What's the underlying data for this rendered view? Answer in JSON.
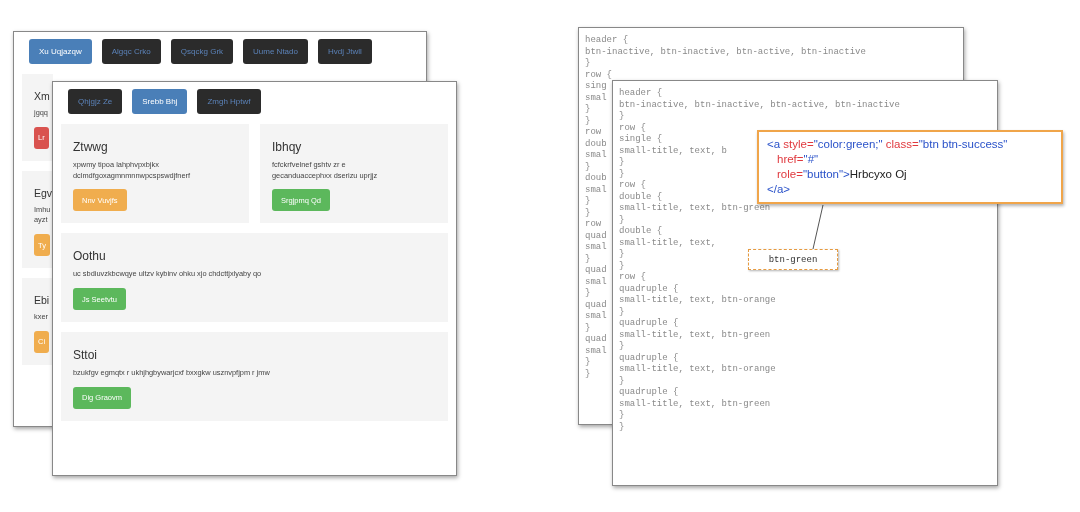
{
  "web_windows": [
    {
      "nav": [
        {
          "label": "Xu Uqjazqw",
          "selected": true
        },
        {
          "label": "Algqc Crko",
          "selected": false
        },
        {
          "label": "Qsqckg Grk",
          "selected": false
        },
        {
          "label": "Uume Ntado",
          "selected": false
        },
        {
          "label": "Hvdj Jtwll",
          "selected": false
        }
      ],
      "rows": [
        {
          "cards": [
            {
              "title": "Xm",
              "lines": [
                "jgqq"
              ],
              "button": {
                "label": "Lr",
                "color": "#d9534f"
              }
            }
          ]
        },
        {
          "cards": [
            {
              "title": "Egv",
              "lines": [
                "Imhu",
                "ayzt"
              ],
              "button": {
                "label": "Ty",
                "color": "#f0ad4e"
              }
            }
          ]
        },
        {
          "cards": [
            {
              "title": "Ebi",
              "lines": [
                "kxer"
              ],
              "button": {
                "label": "Ci",
                "color": "#f0ad4e"
              }
            }
          ]
        }
      ]
    },
    {
      "nav": [
        {
          "label": "Qhjgjz Ze",
          "selected": false
        },
        {
          "label": "Srebb Bhj",
          "selected": true
        },
        {
          "label": "Zmgh Hptwf",
          "selected": false
        }
      ],
      "rows": [
        {
          "cards": [
            {
              "title": "Ztwwg",
              "lines": [
                "xpwmy tipoa lahphvpxbjkx",
                "dclmdfgoxagmnmnnwpcspswdjfnerf"
              ],
              "button": {
                "label": "Nnv Vuvjfs",
                "color": "#f0ad4e"
              }
            },
            {
              "title": "Ibhqy",
              "lines": [
                "fcfckrfvelnef gshtv zr e",
                "gecanduaccephxx dserizu uprjjz"
              ],
              "button": {
                "label": "Srgjpmq Qd",
                "color": "#5cb85c"
              }
            }
          ]
        },
        {
          "cards": [
            {
              "title": "Oothu",
              "lines": [
                "uc sbdiuvzkbcwqye ultzv kybinv ohku xjo chdcttjxlyaby qo"
              ],
              "button": {
                "label": "Js Seetvtu",
                "color": "#5cb85c"
              }
            }
          ]
        },
        {
          "cards": [
            {
              "title": "Sttoi",
              "lines": [
                "bzukfgv egmqtx r ukhjhgbywarjcxf bxxgkw usznvpfjpm r jmw"
              ],
              "button": {
                "label": "Dig Graovm",
                "color": "#5cb85c"
              }
            }
          ]
        }
      ]
    }
  ],
  "code_windows": [
    {
      "lines": [
        "header {",
        "btn-inactive, btn-inactive, btn-active, btn-inactive",
        "}",
        "row {",
        "sing",
        "smal",
        "}",
        "}",
        "row",
        "doub",
        "smal",
        "}",
        "doub",
        "smal",
        "}",
        "}",
        "row",
        "quad",
        "smal",
        "}",
        "quad",
        "smal",
        "}",
        "quad",
        "smal",
        "}",
        "quad",
        "smal",
        "}",
        "}"
      ]
    },
    {
      "lines": [
        "header {",
        "btn-inactive, btn-inactive, btn-active, btn-inactive",
        "}",
        "row {",
        "single {",
        "small-title, text, b",
        "}",
        "}",
        "row {",
        "double {",
        "small-title, text, btn-green",
        "}",
        "double {",
        "small-title, text,",
        "}",
        "}",
        "row {",
        "quadruple {",
        "small-title, text, btn-orange",
        "}",
        "quadruple {",
        "small-title, text, btn-green",
        "}",
        "quadruple {",
        "small-title, text, btn-orange",
        "}",
        "quadruple {",
        "small-title, text, btn-green",
        "}",
        "}"
      ]
    }
  ],
  "callout": {
    "lines": [
      [
        {
          "text": "<a",
          "kind": "tag"
        },
        {
          "text": " style=",
          "kind": "attr"
        },
        {
          "text": "\"color:green;\"",
          "kind": "value"
        },
        {
          "text": " class=",
          "kind": "attr"
        },
        {
          "text": "\"btn btn-success\"",
          "kind": "value"
        }
      ],
      [
        {
          "text": "href=",
          "kind": "attr"
        },
        {
          "text": "\"#\"",
          "kind": "value"
        }
      ],
      [
        {
          "text": "role=",
          "kind": "attr"
        },
        {
          "text": "\"button\"",
          "kind": "value"
        },
        {
          "text": ">",
          "kind": "tag"
        },
        {
          "text": "Hrbcyxo Oj",
          "kind": "text"
        }
      ],
      [
        {
          "text": "</a>",
          "kind": "tag"
        }
      ]
    ]
  },
  "token_tag": {
    "label": "btn-green"
  }
}
